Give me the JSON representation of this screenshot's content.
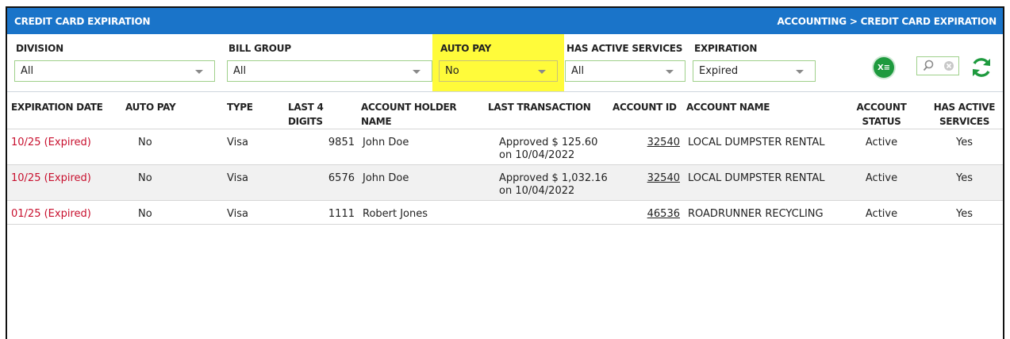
{
  "header": {
    "title": "CREDIT CARD EXPIRATION",
    "breadcrumb": "ACCOUNTING > CREDIT CARD EXPIRATION"
  },
  "colors": {
    "header_bg": "#1a74c9",
    "highlight": "#fffb3a",
    "expired": "#c8102e",
    "excel": "#1e9a3e",
    "refresh": "#1e9a3e"
  },
  "filters": {
    "division": {
      "label": "DIVISION",
      "value": "All"
    },
    "bill_group": {
      "label": "BILL GROUP",
      "value": "All"
    },
    "auto_pay": {
      "label": "AUTO PAY",
      "value": "No"
    },
    "has_active_services": {
      "label": "HAS ACTIVE SERVICES",
      "value": "All"
    },
    "expiration": {
      "label": "EXPIRATION",
      "value": "Expired"
    }
  },
  "toolbar": {
    "excel_icon": "excel-export-icon",
    "search_icon": "search-icon",
    "clear_icon": "clear-icon",
    "refresh_icon": "refresh-icon",
    "excel_label": "X≡"
  },
  "table": {
    "headers": {
      "expiration_date": "EXPIRATION DATE",
      "auto_pay": "AUTO PAY",
      "type": "TYPE",
      "last4": "LAST 4 DIGITS",
      "holder_1": "ACCOUNT HOLDER",
      "holder_2": "NAME",
      "last_tx": "LAST TRANSACTION",
      "account_id": "ACCOUNT ID",
      "account_name": "ACCOUNT NAME",
      "status_1": "ACCOUNT",
      "status_2": "STATUS",
      "active_1": "HAS ACTIVE",
      "active_2": "SERVICES"
    },
    "rows": [
      {
        "expiration": "10/25 (Expired)",
        "auto_pay": "No",
        "type": "Visa",
        "last4": "9851",
        "holder": "John Doe",
        "tx_line1": "Approved $ 125.60",
        "tx_line2": "on 10/04/2022",
        "account_id": "32540",
        "account_name": "LOCAL DUMPSTER RENTAL",
        "status": "Active",
        "active": "Yes"
      },
      {
        "expiration": "10/25 (Expired)",
        "auto_pay": "No",
        "type": "Visa",
        "last4": "6576",
        "holder": "John Doe",
        "tx_line1": "Approved $ 1,032.16",
        "tx_line2": "on 10/04/2022",
        "account_id": "32540",
        "account_name": "LOCAL DUMPSTER RENTAL",
        "status": "Active",
        "active": "Yes"
      },
      {
        "expiration": "01/25 (Expired)",
        "auto_pay": "No",
        "type": "Visa",
        "last4": "1111",
        "holder": "Robert Jones",
        "tx_line1": "",
        "tx_line2": "",
        "account_id": "46536",
        "account_name": "ROADRUNNER RECYCLING",
        "status": "Active",
        "active": "Yes"
      }
    ]
  }
}
